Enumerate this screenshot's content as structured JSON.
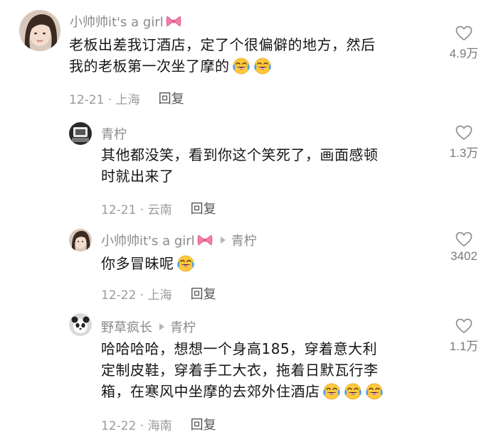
{
  "comments": [
    {
      "author": "小帅帅it's a girl",
      "reply_to": "",
      "lines": [
        "老板出差我订酒店，定了个很偏僻的地方，然后",
        "我的老板第一次坐了摩的"
      ],
      "date_location": "12-21 · 上海",
      "reply_label": "回复",
      "likes": "4.9万",
      "emoji_count": 2
    },
    {
      "author": "青柠",
      "reply_to": "",
      "lines": [
        "其他都没笑，看到你这个笑死了，画面感顿",
        "时就出来了"
      ],
      "date_location": "12-21 · 云南",
      "reply_label": "回复",
      "likes": "1.3万",
      "emoji_count": 0
    },
    {
      "author": "小帅帅it's a girl",
      "reply_to": "青柠",
      "lines": [
        "你多冒昧呢"
      ],
      "date_location": "12-22 · 上海",
      "reply_label": "回复",
      "likes": "3402",
      "emoji_count": 1
    },
    {
      "author": "野草疯长",
      "reply_to": "青柠",
      "lines": [
        "哈哈哈哈，想想一个身高185，穿着意大利",
        "定制皮鞋，穿着手工大衣，拖着日默瓦行李",
        "箱，在寒风中坐摩的去郊外住酒店"
      ],
      "date_location": "12-22 · 海南",
      "reply_label": "回复",
      "likes": "1.1万",
      "emoji_count": 3
    }
  ],
  "icons": {
    "emoji": "laughing-with-tears-icon",
    "bow": "pink-bow-icon",
    "heart": "heart-outline-icon",
    "reply_arrow": "reply-arrow-icon"
  },
  "colors": {
    "name_gray": "#8a8a8a",
    "text": "#151515",
    "meta_gray": "#9a9a9a",
    "bow_pink": "#f27ea9",
    "emoji_yellow": "#ffc93c",
    "tear_blue": "#4da3f0"
  }
}
